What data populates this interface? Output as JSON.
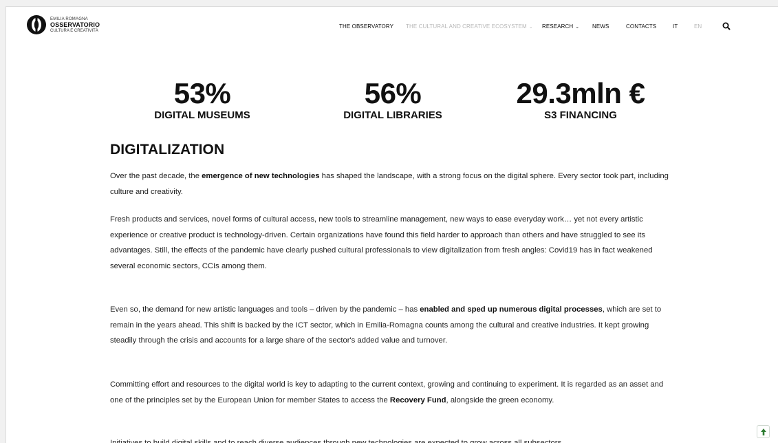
{
  "header": {
    "logo": {
      "line1": "Emilia Romagna",
      "line2": "OSSERVATORIO",
      "line3": "Cultura e Creatività"
    },
    "nav": [
      {
        "label": "THE OBSERVATORY",
        "muted": false,
        "dropdown": false
      },
      {
        "label": "THE CULTURAL AND CREATIVE ECOSYSTEM",
        "muted": true,
        "dropdown": true
      },
      {
        "label": "RESEARCH",
        "muted": false,
        "dropdown": true
      },
      {
        "label": "NEWS",
        "muted": false,
        "dropdown": false
      },
      {
        "label": "CONTACTS",
        "muted": false,
        "dropdown": false
      },
      {
        "label": "IT",
        "muted": false,
        "dropdown": false
      },
      {
        "label": "EN",
        "muted": true,
        "dropdown": false
      }
    ],
    "search_icon": "search-icon"
  },
  "stats": [
    {
      "value": "53%",
      "label": "DIGITAL MUSEUMS"
    },
    {
      "value": "56%",
      "label": "DIGITAL LIBRARIES"
    },
    {
      "value": "29.3mln €",
      "label": "S3 FINANCING"
    }
  ],
  "article": {
    "title": "DIGITALIZATION",
    "p1": {
      "a": "Over the past decade, the ",
      "b": "emergence of new technologies",
      "c": " has shaped the landscape, with a strong focus on the digital sphere. Every sector took part, including culture and creativity."
    },
    "p2": "Fresh products and services, novel forms of cultural access, new tools to streamline management, new ways to ease everyday work… yet not every artistic experience or creative product is technology-driven. Certain organizations have found this field harder to approach than others and have struggled to see its advantages. Still, the effects of the pandemic have clearly pushed cultural professionals to view digitalization from fresh angles: Covid19 has in fact weakened several economic sectors, CCIs among them.",
    "p3": {
      "a": "Even so, the demand for new artistic languages and tools – driven by the pandemic – has ",
      "b": "enabled and sped up numerous digital processes",
      "c": ", which are set to remain in the years ahead. This shift is backed by the ICT sector, which in Emilia-Romagna counts among the cultural and creative industries. It kept growing steadily through the crisis and accounts for a large share of the sector's added value and turnover."
    },
    "p4": {
      "a": "Committing effort and resources to the digital world is key to adapting to the current context, growing and continuing to experiment. It is regarded as an asset and one of the principles set by the European Union for member States to access the ",
      "b": "Recovery Fund",
      "c": ", alongside the green economy."
    },
    "p5": "Initiatives to build digital skills and to reach diverse audiences through new technologies are expected to grow across all subsectors"
  },
  "scroll_top_icon": "arrow-up-icon",
  "colors": {
    "accent": "#2e7d32",
    "muted_nav": "#b8b8b8",
    "text": "#222222"
  }
}
